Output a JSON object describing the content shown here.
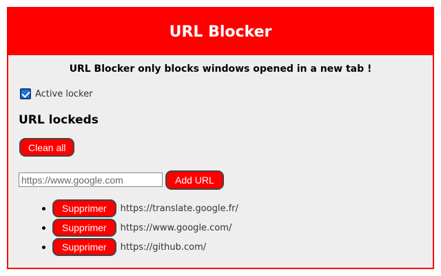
{
  "header": {
    "title": "URL Blocker"
  },
  "notice": "URL Blocker only blocks windows opened in a new tab !",
  "active": {
    "label": "Active locker",
    "checked": true
  },
  "section_title": "URL lockeds",
  "clean_label": "Clean all",
  "input": {
    "placeholder": "https://www.google.com",
    "value": ""
  },
  "add_label": "Add URL",
  "urls": [
    {
      "button": "Supprimer",
      "url": "https://translate.google.fr/"
    },
    {
      "button": "Supprimer",
      "url": "https://www.google.com/"
    },
    {
      "button": "Supprimer",
      "url": "https://github.com/"
    }
  ],
  "colors": {
    "accent": "#ff0000",
    "background": "#eeeeee",
    "checkbox": "#1a73e8"
  }
}
